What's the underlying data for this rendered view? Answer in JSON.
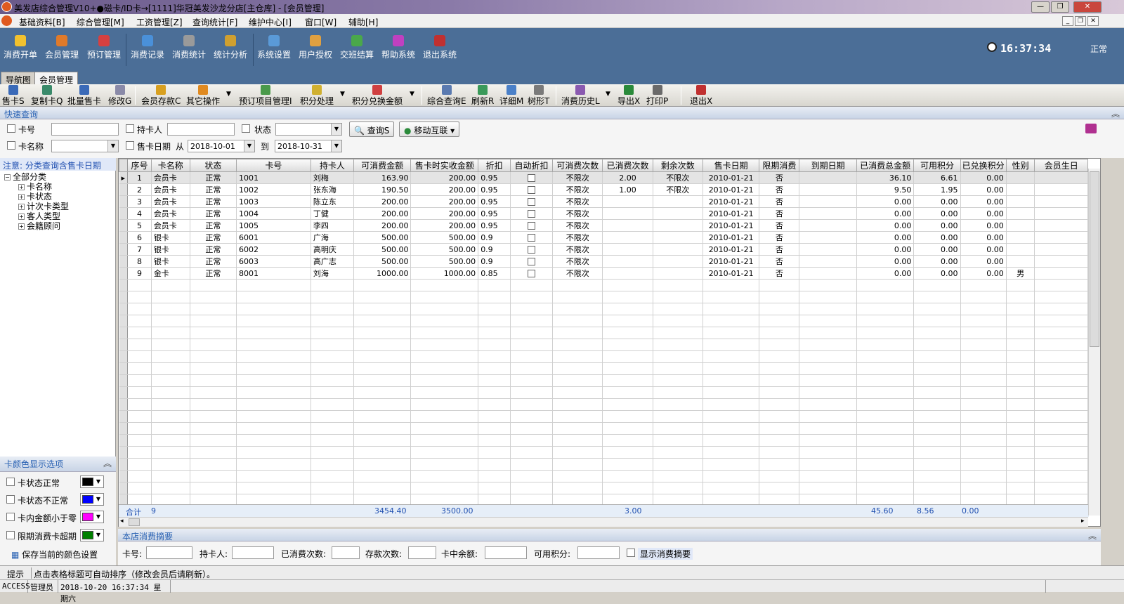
{
  "window": {
    "title": "美发店综合管理V10+●磁卡/ID卡→[1111]华冠美发沙龙分店[主仓库] - [会员管理]"
  },
  "menu": [
    "基础资料[B]",
    "综合管理[M]",
    "工资管理[Z]",
    "查询统计[F]",
    "维护中心[I]",
    "窗口[W]",
    "辅助[H]"
  ],
  "main_toolbar": [
    {
      "label": "消费开单",
      "color": "#f2c12e"
    },
    {
      "label": "会员管理",
      "color": "#e07a2a"
    },
    {
      "label": "预订管理",
      "color": "#d64040"
    },
    {
      "label": "消费记录",
      "color": "#4a90d9"
    },
    {
      "label": "消费统计",
      "color": "#7a7a7a"
    },
    {
      "label": "统计分析",
      "color": "#d0a030"
    },
    {
      "label": "系统设置",
      "color": "#5a9ad8"
    },
    {
      "label": "用户授权",
      "color": "#e0a040"
    },
    {
      "label": "交班结算",
      "color": "#4aa84a"
    },
    {
      "label": "帮助系统",
      "color": "#c040c0"
    },
    {
      "label": "退出系统",
      "color": "#c03030"
    }
  ],
  "clock": "16:37:34",
  "status_top": "正常",
  "tabs": [
    "导航图",
    "会员管理"
  ],
  "toolbar2": [
    "售卡S",
    "复制卡Q",
    "批量售卡",
    "修改G",
    "会员存款C",
    "其它操作",
    "预订项目管理I",
    "积分处理",
    "积分兑换金额",
    "综合查询E",
    "刷新R",
    "详细M",
    "树形T",
    "消费历史L",
    "导出X",
    "打印P",
    "退出X"
  ],
  "quick": {
    "title": "快速查询",
    "card_no": "卡号",
    "holder": "持卡人",
    "status": "状态",
    "card_name": "卡名称",
    "sale_date": "售卡日期",
    "from": "从",
    "date_from": "2018-10-01",
    "to": "到",
    "date_to": "2018-10-31",
    "query_btn": "查询S",
    "mobile_btn": "移动互联"
  },
  "left": {
    "notice": "注意: 分类查询含售卡日期",
    "tree_root": "全部分类",
    "tree": [
      "卡名称",
      "卡状态",
      "计次卡类型",
      "客人类型",
      "会籍顾问"
    ],
    "color_title": "卡颜色显示选项",
    "colors": [
      {
        "label": "卡状态正常",
        "color": "#000000"
      },
      {
        "label": "卡状态不正常",
        "color": "#0000ff"
      },
      {
        "label": "卡内金额小于零",
        "color": "#ff00ff"
      },
      {
        "label": "限期消费卡超期",
        "color": "#008000"
      }
    ],
    "save_colors": "保存当前的颜色设置"
  },
  "grid": {
    "headers": [
      "序号",
      "卡名称",
      "状态",
      "卡号",
      "持卡人",
      "可消费金额",
      "售卡时实收金额",
      "折扣",
      "自动折扣",
      "可消费次数",
      "已消费次数",
      "剩余次数",
      "售卡日期",
      "限期消费",
      "到期日期",
      "已消费总金额",
      "可用积分",
      "已兑换积分",
      "性别",
      "会员生日"
    ],
    "rows": [
      [
        "1",
        "会员卡",
        "正常",
        "1001",
        "刘梅",
        "163.90",
        "200.00",
        "0.95",
        "",
        "不限次",
        "2.00",
        "不限次",
        "2010-01-21",
        "否",
        "",
        "36.10",
        "6.61",
        "0.00",
        "",
        ""
      ],
      [
        "2",
        "会员卡",
        "正常",
        "1002",
        "张东海",
        "190.50",
        "200.00",
        "0.95",
        "",
        "不限次",
        "1.00",
        "不限次",
        "2010-01-21",
        "否",
        "",
        "9.50",
        "1.95",
        "0.00",
        "",
        ""
      ],
      [
        "3",
        "会员卡",
        "正常",
        "1003",
        "陈立东",
        "200.00",
        "200.00",
        "0.95",
        "",
        "不限次",
        "",
        "",
        "2010-01-21",
        "否",
        "",
        "0.00",
        "0.00",
        "0.00",
        "",
        ""
      ],
      [
        "4",
        "会员卡",
        "正常",
        "1004",
        "丁健",
        "200.00",
        "200.00",
        "0.95",
        "",
        "不限次",
        "",
        "",
        "2010-01-21",
        "否",
        "",
        "0.00",
        "0.00",
        "0.00",
        "",
        ""
      ],
      [
        "5",
        "会员卡",
        "正常",
        "1005",
        "李四",
        "200.00",
        "200.00",
        "0.95",
        "",
        "不限次",
        "",
        "",
        "2010-01-21",
        "否",
        "",
        "0.00",
        "0.00",
        "0.00",
        "",
        ""
      ],
      [
        "6",
        "银卡",
        "正常",
        "6001",
        "广海",
        "500.00",
        "500.00",
        "0.9",
        "",
        "不限次",
        "",
        "",
        "2010-01-21",
        "否",
        "",
        "0.00",
        "0.00",
        "0.00",
        "",
        ""
      ],
      [
        "7",
        "银卡",
        "正常",
        "6002",
        "高明庆",
        "500.00",
        "500.00",
        "0.9",
        "",
        "不限次",
        "",
        "",
        "2010-01-21",
        "否",
        "",
        "0.00",
        "0.00",
        "0.00",
        "",
        ""
      ],
      [
        "8",
        "银卡",
        "正常",
        "6003",
        "高广志",
        "500.00",
        "500.00",
        "0.9",
        "",
        "不限次",
        "",
        "",
        "2010-01-21",
        "否",
        "",
        "0.00",
        "0.00",
        "0.00",
        "",
        ""
      ],
      [
        "9",
        "金卡",
        "正常",
        "8001",
        "刘海",
        "1000.00",
        "1000.00",
        "0.85",
        "",
        "不限次",
        "",
        "",
        "2010-01-21",
        "否",
        "",
        "0.00",
        "0.00",
        "0.00",
        "男",
        ""
      ]
    ],
    "sum": {
      "label": "合计",
      "count": "9",
      "amount": "3454.40",
      "paid": "3500.00",
      "used_times": "3.00",
      "total_spent": "45.60",
      "points": "8.56",
      "exchanged": "0.00"
    }
  },
  "summary": {
    "title": "本店消费摘要",
    "card_no": "卡号:",
    "holder": "持卡人:",
    "used": "已消费次数:",
    "deposit": "存款次数:",
    "balance": "卡中余额:",
    "points": "可用积分:",
    "show": "显示消费摘要"
  },
  "hint": {
    "label": "提示",
    "text": "点击表格标题可自动排序（修改会员后请刷新）。"
  },
  "statusbar": [
    "ACCESS",
    "管理员",
    "2018-10-20 16:37:34 星期六"
  ]
}
